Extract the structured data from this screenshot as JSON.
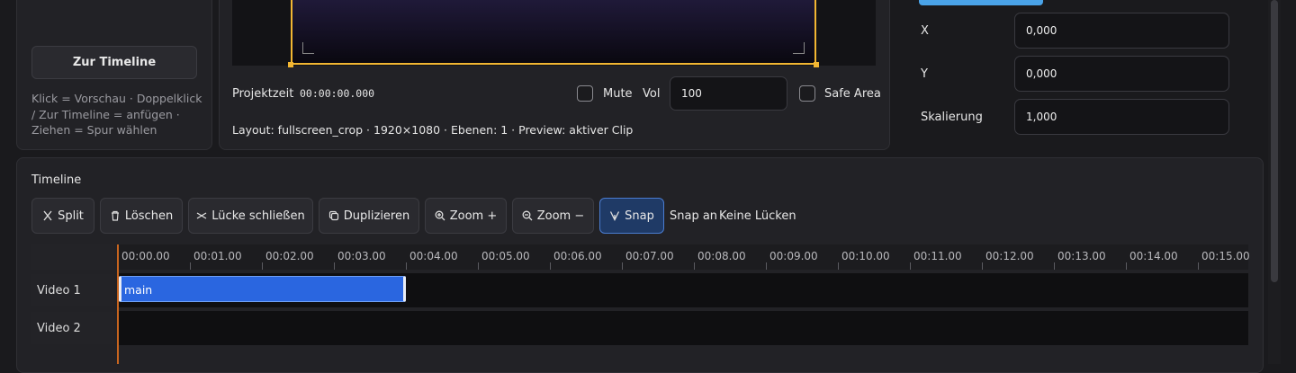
{
  "media_panel": {
    "to_timeline_label": "Zur Timeline",
    "hint": "Klick = Vorschau · Doppelklick / Zur Timeline = anfügen · Ziehen = Spur wählen"
  },
  "preview": {
    "project_time_label": "Projektzeit",
    "project_time_value": "00:00:00.000",
    "mute_label": "Mute",
    "vol_label": "Vol",
    "vol_value": "100",
    "safe_area_label": "Safe Area",
    "layout_info": "Layout: fullscreen_crop · 1920×1080 · Ebenen: 1 · Preview: aktiver Clip"
  },
  "inspector": {
    "x_label": "X",
    "x_value": "0,000",
    "y_label": "Y",
    "y_value": "0,000",
    "scale_label": "Skalierung",
    "scale_value": "1,000"
  },
  "timeline": {
    "title": "Timeline",
    "toolbar": {
      "split": "Split",
      "delete": "Löschen",
      "close_gap": "Lücke schließen",
      "duplicate": "Duplizieren",
      "zoom_in": "Zoom +",
      "zoom_out": "Zoom −",
      "snap": "Snap"
    },
    "snap_status": "Snap an",
    "gap_status": "Keine Lücken",
    "ruler": [
      "00:00.00",
      "00:01.00",
      "00:02.00",
      "00:03.00",
      "00:04.00",
      "00:05.00",
      "00:06.00",
      "00:07.00",
      "00:08.00",
      "00:09.00",
      "00:10.00",
      "00:11.00",
      "00:12.00",
      "00:13.00",
      "00:14.00",
      "00:15.00"
    ],
    "tracks": [
      {
        "name": "Video 1",
        "clip": "main"
      },
      {
        "name": "Video 2"
      }
    ]
  },
  "colors": {
    "accent": "#2a66e0",
    "preview_frame": "#f2b632",
    "snap_active_bg": "#1f3a66"
  }
}
